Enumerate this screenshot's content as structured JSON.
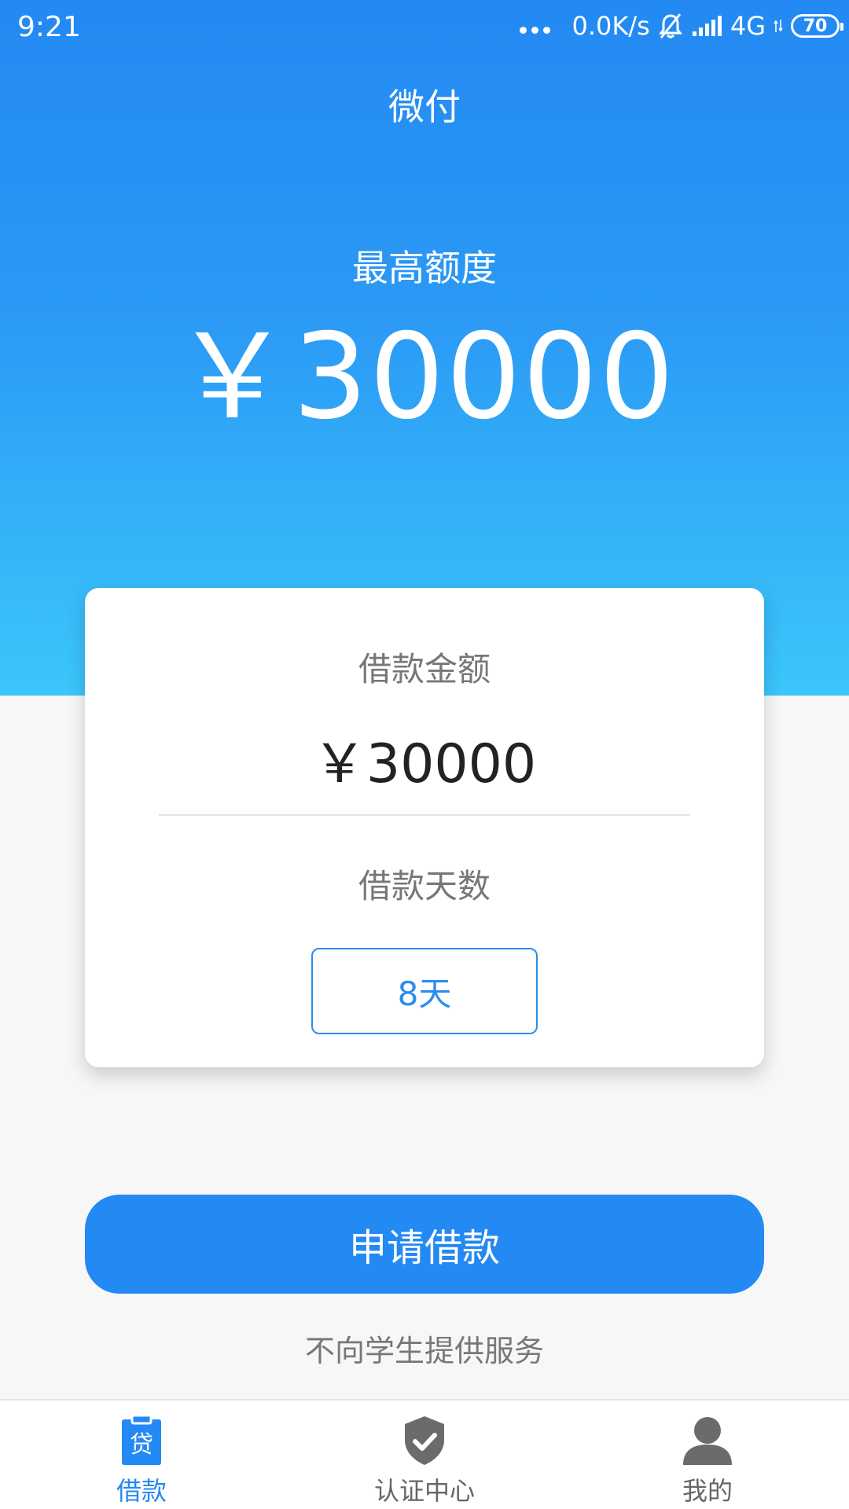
{
  "status_bar": {
    "time": "9:21",
    "speed": "0.0K/s",
    "network": "4G",
    "battery": "70"
  },
  "header": {
    "title": "微付"
  },
  "hero": {
    "max_label": "最高额度",
    "max_amount": "￥30000"
  },
  "card": {
    "amount_label": "借款金额",
    "amount_value": "￥30000",
    "days_label": "借款天数",
    "days_value": "8天"
  },
  "actions": {
    "apply_label": "申请借款",
    "notice": "不向学生提供服务"
  },
  "tabbar": {
    "items": [
      {
        "label": "借款",
        "icon": "loan-icon",
        "active": true,
        "icon_text": "贷"
      },
      {
        "label": "认证中心",
        "icon": "shield-check-icon",
        "active": false
      },
      {
        "label": "我的",
        "icon": "user-icon",
        "active": false
      }
    ]
  },
  "colors": {
    "primary": "#2389f3",
    "hero_bottom": "#3bc6fb",
    "inactive_icon": "#6b6b6b"
  }
}
